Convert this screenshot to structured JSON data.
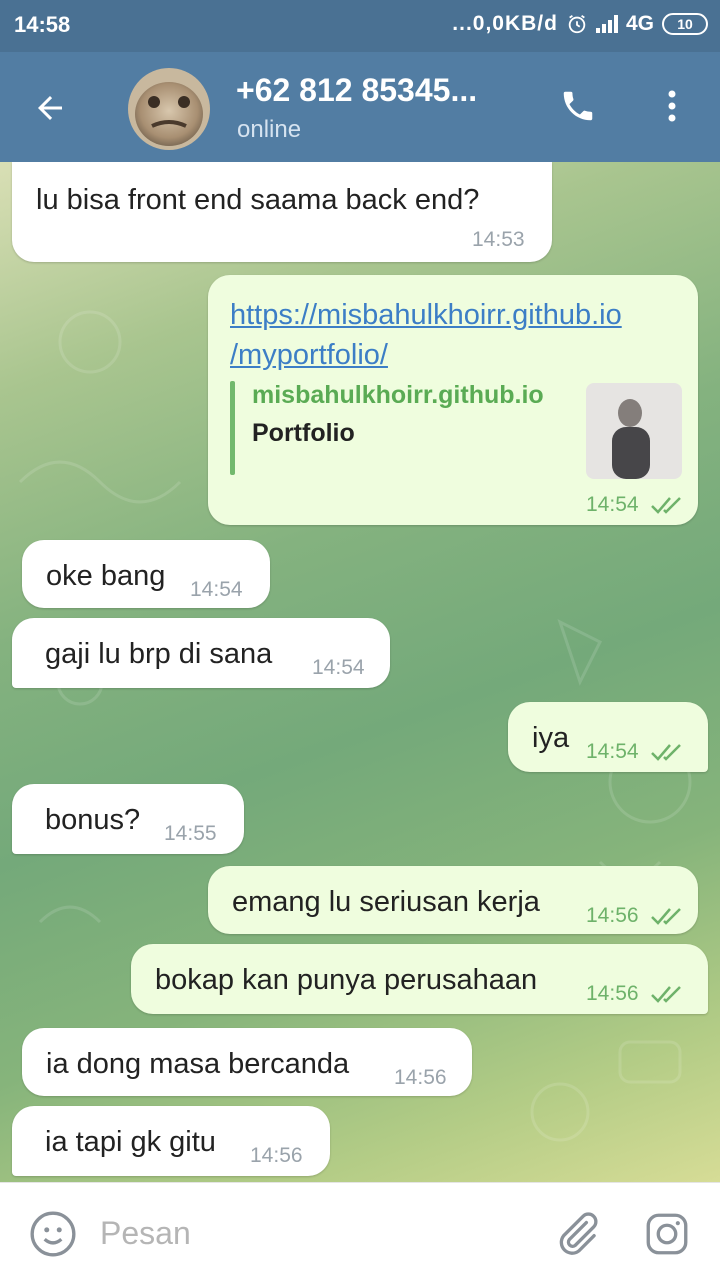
{
  "status_bar": {
    "time": "14:58",
    "network_speed": "...0,0KB/d",
    "network_type": "4G",
    "battery": "10"
  },
  "header": {
    "contact_name": "+62 812 85345...",
    "contact_status": "online",
    "icons": [
      "arrow-back-icon",
      "phone-icon",
      "more-vert-icon"
    ]
  },
  "messages": [
    {
      "direction": "in",
      "text": "lu bisa front end saama back end?",
      "time": "14:53"
    },
    {
      "direction": "out",
      "type": "link",
      "link_line1": "https://misbahulkhoirr.github.io",
      "link_line2": "/myportfolio/",
      "preview_site": "misbahulkhoirr.github.io",
      "preview_title": "Portfolio",
      "time": "14:54",
      "read": true
    },
    {
      "direction": "in",
      "text": "oke bang",
      "time": "14:54"
    },
    {
      "direction": "in",
      "text": "gaji lu brp di sana",
      "time": "14:54"
    },
    {
      "direction": "out",
      "text": "iya",
      "time": "14:54",
      "read": true
    },
    {
      "direction": "in",
      "text": "bonus?",
      "time": "14:55"
    },
    {
      "direction": "out",
      "text": "emang lu seriusan kerja",
      "time": "14:56",
      "read": true
    },
    {
      "direction": "out",
      "text": "bokap kan punya perusahaan",
      "time": "14:56",
      "read": true
    },
    {
      "direction": "in",
      "text": "ia dong masa bercanda",
      "time": "14:56"
    },
    {
      "direction": "in",
      "text": "ia tapi gk gitu",
      "time": "14:56"
    }
  ],
  "input": {
    "placeholder": "Pesan",
    "value": ""
  },
  "colors": {
    "status_bar": "#4a7193",
    "header": "#527da3",
    "incoming_bubble": "#ffffff",
    "outgoing_bubble": "#effdde",
    "link": "#3c7ec6",
    "outgoing_time": "#6eb26a"
  }
}
